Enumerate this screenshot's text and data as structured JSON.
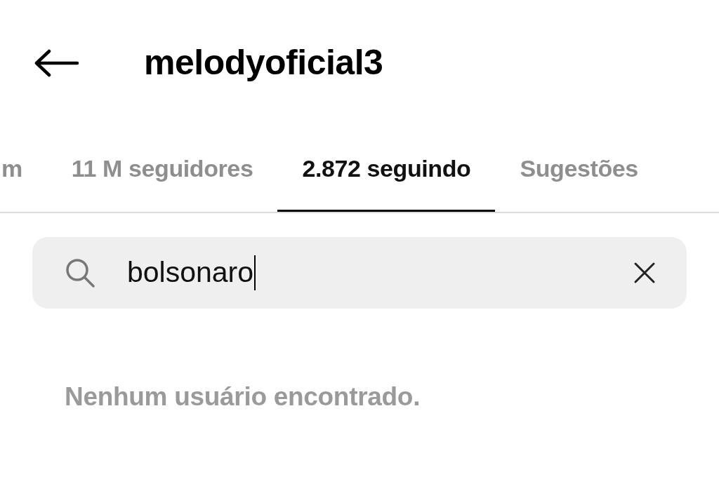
{
  "header": {
    "title": "melodyoficial3"
  },
  "tabs": [
    {
      "label": "m",
      "selected": false
    },
    {
      "label": "11 M seguidores",
      "selected": false
    },
    {
      "label": "2.872 seguindo",
      "selected": true
    },
    {
      "label": "Sugestões",
      "selected": false
    }
  ],
  "search": {
    "value": "bolsonaro"
  },
  "empty_message": "Nenhum usuário encontrado."
}
